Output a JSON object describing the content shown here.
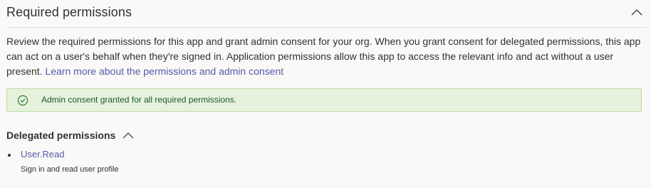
{
  "section": {
    "title": "Required permissions",
    "collapse_icon": "chevron-up-icon"
  },
  "description": {
    "text": "Review the required permissions for this app and grant admin consent for your org. When you grant consent for delegated permissions, this app can act on a user's behalf when they're signed in. Application permissions allow this app to access the relevant info and act without a user present. ",
    "link_text": "Learn more about the permissions and admin consent"
  },
  "banner": {
    "icon": "check-circle-icon",
    "text": "Admin consent granted for all required permissions.",
    "background": "#e6f2dc",
    "text_color": "#1a5b2e"
  },
  "delegated": {
    "label": "Delegated permissions",
    "toggle_icon": "chevron-up-icon",
    "items": [
      {
        "name": "User.Read",
        "description": "Sign in and read user profile"
      }
    ]
  },
  "colors": {
    "link": "#5659a8",
    "text": "#323130",
    "background": "#faf9f8"
  }
}
